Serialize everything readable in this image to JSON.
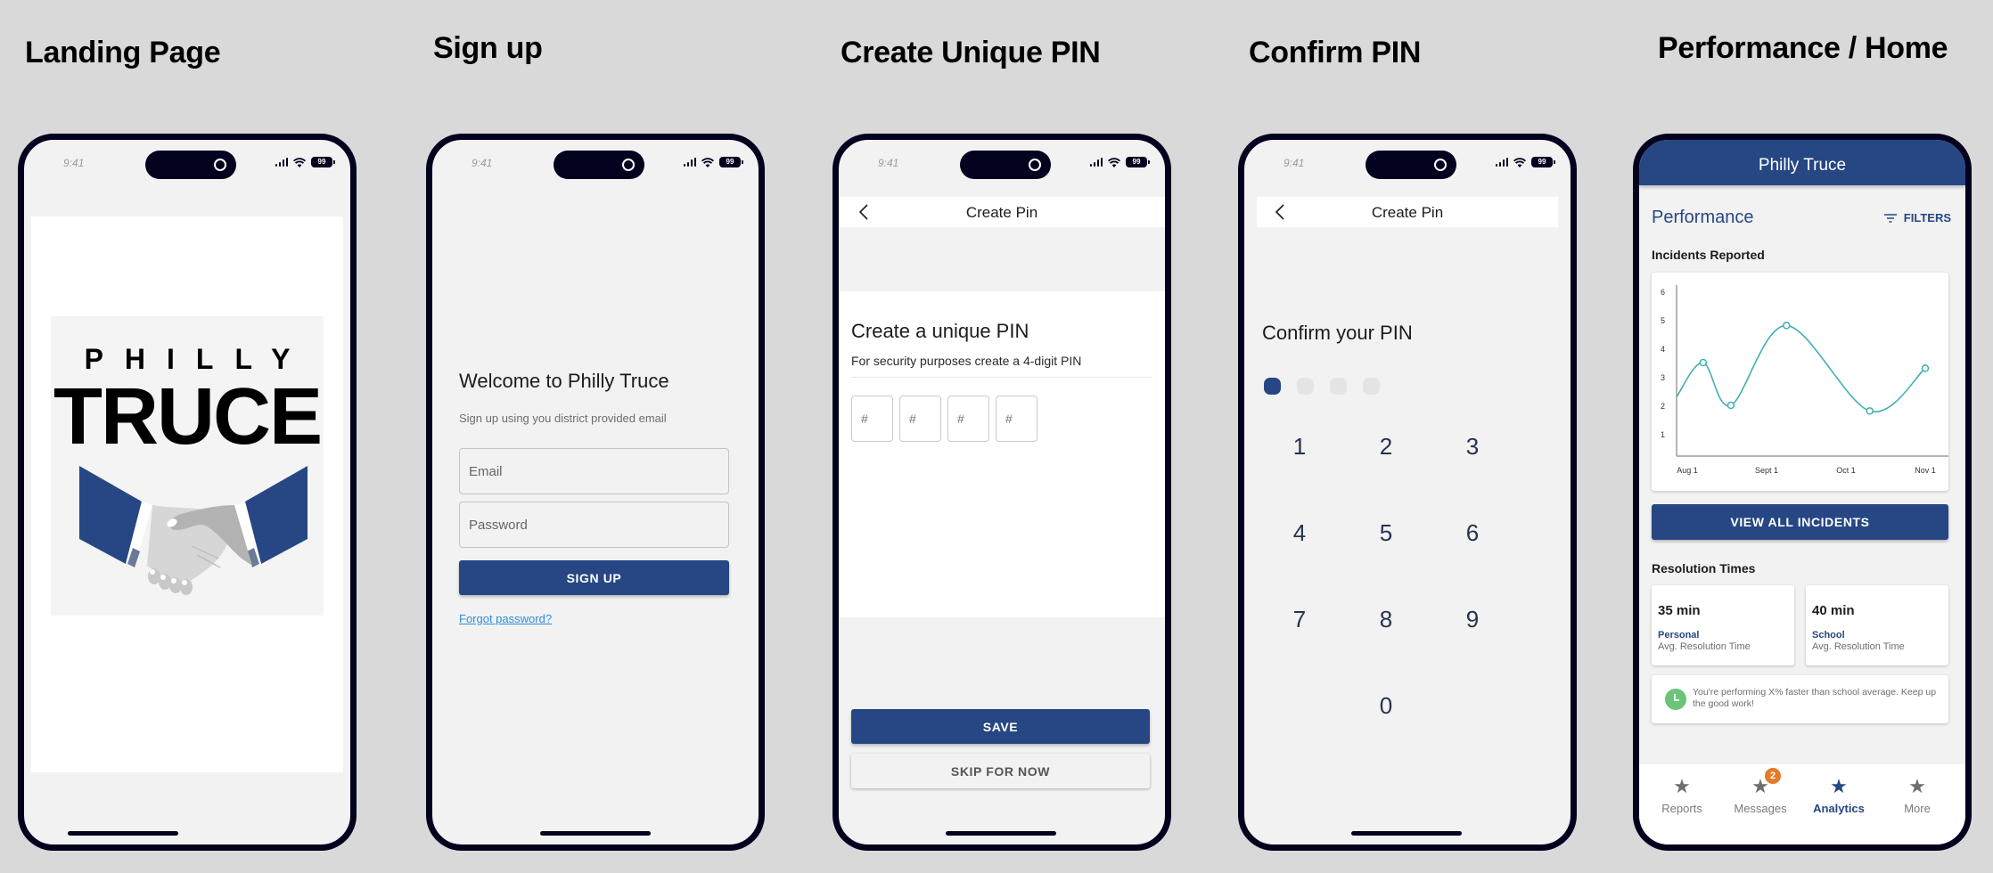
{
  "screens": [
    {
      "title": "Landing Page"
    },
    {
      "title": "Sign up"
    },
    {
      "title": "Create Unique PIN"
    },
    {
      "title": "Confirm PIN"
    },
    {
      "title": "Performance / Home"
    }
  ],
  "status_bar": {
    "time": "9:41",
    "battery": "99"
  },
  "landing": {
    "logo_line1": "PHILLY",
    "logo_line2": "TRUCE",
    "logo_icon": "handshake-icon",
    "colors": {
      "sleeve": "#264784",
      "hand_light": "#d6d6d6",
      "hand_dark": "#b3b3b3"
    }
  },
  "signup": {
    "heading": "Welcome to Philly Truce",
    "subheading": "Sign up using you district provided email",
    "email_placeholder": "Email",
    "password_placeholder": "Password",
    "signup_button": "SIGN UP",
    "forgot_link": "Forgot password?"
  },
  "create_pin": {
    "nav_title": "Create Pin",
    "back_icon": "chevron-left-icon",
    "heading": "Create a unique PIN",
    "subheading": "For security purposes create a 4-digit PIN",
    "pin_placeholders": [
      "#",
      "#",
      "#",
      "#"
    ],
    "save_button": "SAVE",
    "skip_button": "SKIP FOR NOW"
  },
  "confirm_pin": {
    "nav_title": "Create Pin",
    "back_icon": "chevron-left-icon",
    "heading": "Confirm your PIN",
    "digits_entered": 1,
    "digits_total": 4,
    "keypad": [
      "1",
      "2",
      "3",
      "4",
      "5",
      "6",
      "7",
      "8",
      "9",
      "0"
    ]
  },
  "home": {
    "app_title": "Philly Truce",
    "section_title": "Performance",
    "filters_label": "FILTERS",
    "filters_icon": "filter-icon",
    "incidents_label": "Incidents Reported",
    "view_all_button": "VIEW ALL INCIDENTS",
    "resolution_label": "Resolution Times",
    "stats": [
      {
        "value": "35 min",
        "label": "Personal",
        "sub": "Avg. Resolution Time"
      },
      {
        "value": "40 min",
        "label": "School",
        "sub": "Avg. Resolution Time"
      }
    ],
    "info_icon": "clock-icon",
    "info_text": "You're performing X% faster than school average. Keep up the good work!",
    "tabs": [
      {
        "label": "Reports",
        "icon": "star-icon",
        "active": false,
        "badge": null
      },
      {
        "label": "Messages",
        "icon": "star-icon",
        "active": false,
        "badge": "2"
      },
      {
        "label": "Analytics",
        "icon": "star-icon",
        "active": true,
        "badge": null
      },
      {
        "label": "More",
        "icon": "star-icon",
        "active": false,
        "badge": null
      }
    ],
    "colors": {
      "primary": "#264784",
      "line": "#3fb0b0",
      "badge": "#e47a2b",
      "success": "#6ac47a"
    }
  },
  "chart_data": {
    "type": "line",
    "title": "Incidents Reported",
    "xlabel": "",
    "ylabel": "",
    "x_tick_labels": [
      "Aug 1",
      "Sept 1",
      "Oct 1",
      "Nov 1"
    ],
    "x_ticks": [
      0,
      1,
      2,
      3
    ],
    "y_ticks": [
      1,
      2,
      3,
      4,
      5,
      6
    ],
    "ylim": [
      0.5,
      6.3
    ],
    "xlim": [
      -0.3,
      3.4
    ],
    "grid": false,
    "smooth": true,
    "series": [
      {
        "name": "Incidents",
        "x": [
          -0.3,
          0.2,
          0.55,
          1.25,
          2.3,
          3.0
        ],
        "y": [
          2.3,
          3.5,
          2.0,
          4.8,
          1.8,
          3.3
        ],
        "markers": [
          false,
          true,
          true,
          true,
          true,
          true
        ]
      }
    ]
  }
}
